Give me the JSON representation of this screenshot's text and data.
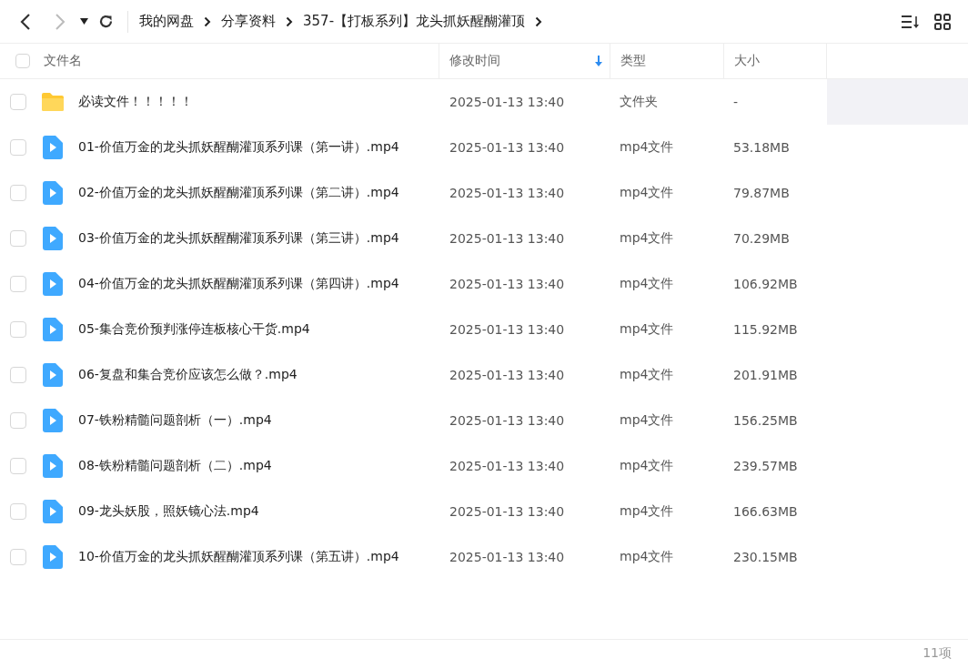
{
  "breadcrumbs": [
    "我的网盘",
    "分享资料",
    "357-【打板系列】龙头抓妖醒醐灌顶"
  ],
  "columns": [
    {
      "label": "文件名",
      "sorted": false
    },
    {
      "label": "修改时间",
      "sorted": true
    },
    {
      "label": "类型",
      "sorted": false
    },
    {
      "label": "大小",
      "sorted": false
    }
  ],
  "select_all_checked": false,
  "rows": [
    {
      "kind": "folder",
      "name": "必读文件！！！！！",
      "modified": "2025-01-13 13:40",
      "type": "文件夹",
      "size": "-",
      "checked": false,
      "highlighted": true
    },
    {
      "kind": "video",
      "name": "01-价值万金的龙头抓妖醒醐灌顶系列课（第一讲）.mp4",
      "modified": "2025-01-13 13:40",
      "type": "mp4文件",
      "size": "53.18MB",
      "checked": false,
      "highlighted": false
    },
    {
      "kind": "video",
      "name": "02-价值万金的龙头抓妖醒醐灌顶系列课（第二讲）.mp4",
      "modified": "2025-01-13 13:40",
      "type": "mp4文件",
      "size": "79.87MB",
      "checked": false,
      "highlighted": false
    },
    {
      "kind": "video",
      "name": "03-价值万金的龙头抓妖醒醐灌顶系列课（第三讲）.mp4",
      "modified": "2025-01-13 13:40",
      "type": "mp4文件",
      "size": "70.29MB",
      "checked": false,
      "highlighted": false
    },
    {
      "kind": "video",
      "name": "04-价值万金的龙头抓妖醒醐灌顶系列课（第四讲）.mp4",
      "modified": "2025-01-13 13:40",
      "type": "mp4文件",
      "size": "106.92MB",
      "checked": false,
      "highlighted": false
    },
    {
      "kind": "video",
      "name": "05-集合竞价预判涨停连板核心干货.mp4",
      "modified": "2025-01-13 13:40",
      "type": "mp4文件",
      "size": "115.92MB",
      "checked": false,
      "highlighted": false
    },
    {
      "kind": "video",
      "name": "06-复盘和集合竞价应该怎么做？.mp4",
      "modified": "2025-01-13 13:40",
      "type": "mp4文件",
      "size": "201.91MB",
      "checked": false,
      "highlighted": false
    },
    {
      "kind": "video",
      "name": "07-铁粉精髓问题剖析（一）.mp4",
      "modified": "2025-01-13 13:40",
      "type": "mp4文件",
      "size": "156.25MB",
      "checked": false,
      "highlighted": false
    },
    {
      "kind": "video",
      "name": "08-铁粉精髓问题剖析（二）.mp4",
      "modified": "2025-01-13 13:40",
      "type": "mp4文件",
      "size": "239.57MB",
      "checked": false,
      "highlighted": false
    },
    {
      "kind": "video",
      "name": "09-龙头妖股，照妖镜心法.mp4",
      "modified": "2025-01-13 13:40",
      "type": "mp4文件",
      "size": "166.63MB",
      "checked": false,
      "highlighted": false
    },
    {
      "kind": "video",
      "name": "10-价值万金的龙头抓妖醒醐灌顶系列课（第五讲）.mp4",
      "modified": "2025-01-13 13:40",
      "type": "mp4文件",
      "size": "230.15MB",
      "checked": false,
      "highlighted": false
    }
  ],
  "item_count": "11项"
}
